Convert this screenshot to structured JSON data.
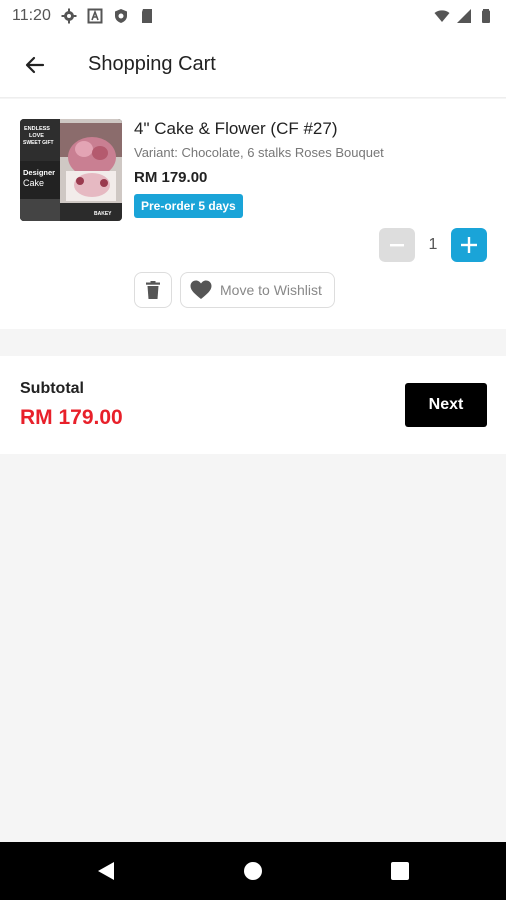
{
  "status_bar": {
    "time": "11:20",
    "left_icons": [
      "gear-icon",
      "a-icon",
      "shield-icon",
      "sd-card-icon"
    ],
    "right_icons": [
      "wifi-icon",
      "signal-icon",
      "battery-icon"
    ]
  },
  "header": {
    "title": "Shopping Cart"
  },
  "cart": {
    "items": [
      {
        "title": "4\" Cake & Flower (CF #27)",
        "variant": "Variant: Chocolate, 6 stalks Roses Bouquet",
        "price": "RM 179.00",
        "badge": "Pre-order 5 days",
        "quantity": "1",
        "wishlist_label": "Move to Wishlist",
        "thumbnail_text": {
          "line1": "ENDLESS",
          "line2": "LOVE",
          "line3": "SWEET GIFT",
          "line4": "Designer",
          "line5": "Cake",
          "brand": "BAKEY"
        }
      }
    ]
  },
  "summary": {
    "subtotal_label": "Subtotal",
    "subtotal_value": "RM 179.00",
    "next_label": "Next"
  },
  "colors": {
    "accent": "#1aa4d8",
    "price_red": "#e8202a",
    "next_button": "#000000"
  }
}
